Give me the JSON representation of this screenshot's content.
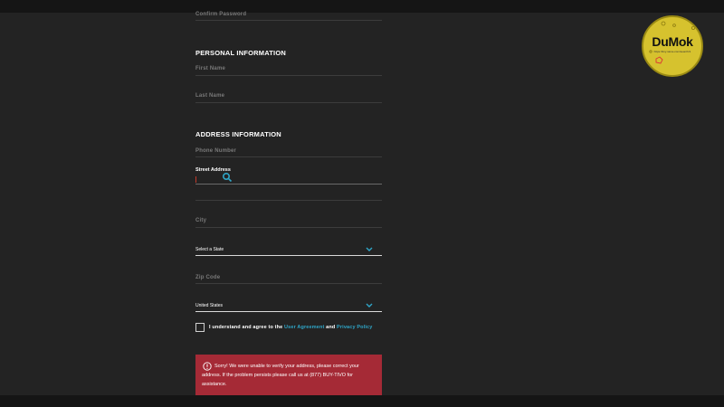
{
  "form": {
    "confirm_password": {
      "label": "Confirm Password"
    },
    "personal": {
      "title": "PERSONAL INFORMATION",
      "first_name": "First Name",
      "last_name": "Last Name"
    },
    "address": {
      "title": "ADDRESS INFORMATION",
      "phone": "Phone Number",
      "street_label": "Street Address",
      "street_value": "",
      "city": "City",
      "state_select": "Select a State",
      "zip": "Zip Code",
      "country_select": "United States"
    },
    "agreement": {
      "prefix": "I understand and agree to the ",
      "user_agreement": "User Agreement",
      "and": " and ",
      "privacy_policy": "Privacy Policy",
      "checked": false
    },
    "error": {
      "message": "Sorry! We were unable to verify your address, please correct your address. If the problem persists please call us at (877) BUY-TIVO for assistance."
    }
  },
  "watermark": {
    "name": "DuMok",
    "url": "https://tiny.name.com/search/1"
  },
  "colors": {
    "background": "#232323",
    "link": "#2fa6c8",
    "error": "#a52a36",
    "badge": "#d6c22e"
  },
  "icons": {
    "chevron": "chevron-down-icon",
    "alert": "alert-circle-icon",
    "cursor": "search-cursor-icon"
  }
}
